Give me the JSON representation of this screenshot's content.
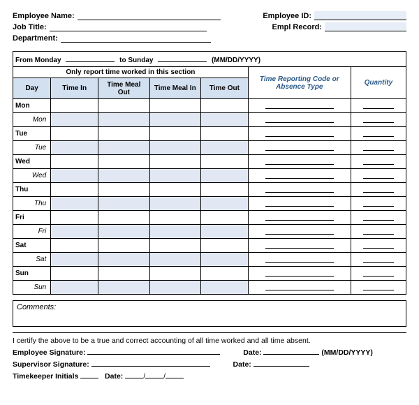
{
  "header": {
    "empname_label": "Employee Name:",
    "empid_label": "Employee ID:",
    "jobtitle_label": "Job Title:",
    "emplrec_label": "Empl Record:",
    "dept_label": "Department:"
  },
  "daterow": {
    "from": "From Monday",
    "to": "to Sunday",
    "fmt": "(MM/DD/YYYY)"
  },
  "section_title": "Only report time worked in this section",
  "cols": {
    "day": "Day",
    "timein": "Time In",
    "mealout": "Time Meal Out",
    "mealin": "Time Meal In",
    "timeout": "Time Out",
    "code": "Time Reporting Code or Absence Type",
    "qty": "Quantity"
  },
  "days": [
    {
      "main": "Mon",
      "sub": "Mon"
    },
    {
      "main": "Tue",
      "sub": "Tue"
    },
    {
      "main": "Wed",
      "sub": "Wed"
    },
    {
      "main": "Thu",
      "sub": "Thu"
    },
    {
      "main": "Fri",
      "sub": "Fri"
    },
    {
      "main": "Sat",
      "sub": "Sat"
    },
    {
      "main": "Sun",
      "sub": "Sun"
    }
  ],
  "comments_label": "Comments:",
  "cert": {
    "text": "I certify the above to be a true and correct accounting of all time worked and all time absent.",
    "empsig": "Employee Signature:",
    "date_label": "Date:",
    "datefmt": "(MM/DD/YYYY)",
    "supsig": "Supervisor Signature:",
    "tk": "Timekeeper Initials",
    "slash": "/"
  }
}
